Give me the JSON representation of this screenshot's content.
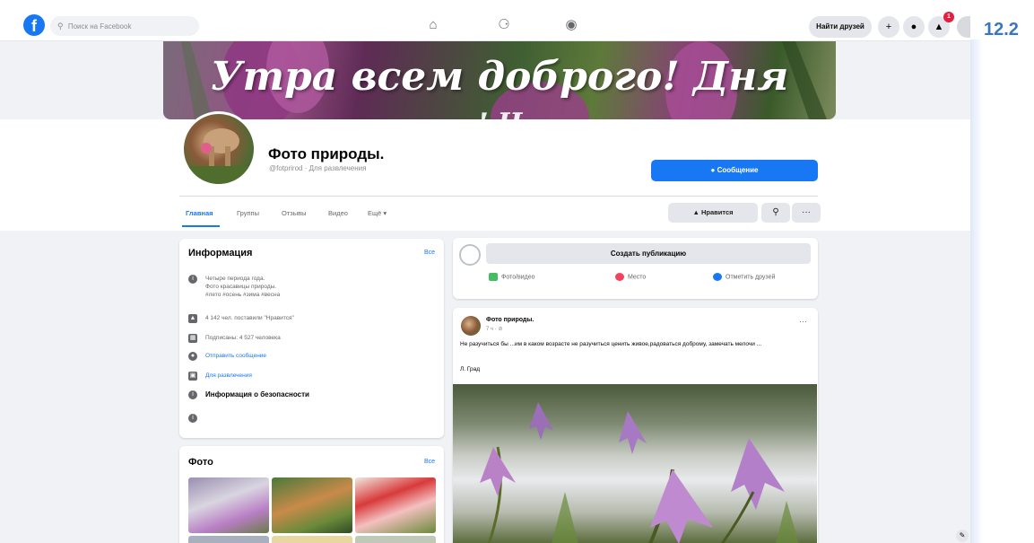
{
  "topbar": {
    "search_placeholder": "Поиск на Facebook",
    "find_friends": "Найти друзей",
    "notif_count": "1",
    "icons": [
      "facebook-logo",
      "search-icon",
      "home-icon",
      "friends-icon",
      "groups-icon",
      "plus-icon",
      "messenger-icon",
      "bell-icon"
    ]
  },
  "cover": {
    "line1": "Утра всем доброго! Дня",
    "line2": "! Ч"
  },
  "profile": {
    "name": "Фото природы.",
    "subtitle": "@fotprirod · Для развлечения",
    "message_button": "Сообщение"
  },
  "tabs": [
    "Главная",
    "Группы",
    "Отзывы",
    "Видео",
    "Ещё ▾"
  ],
  "actions": {
    "like": "Нравится"
  },
  "info": {
    "title": "Информация",
    "see_all": "Все",
    "description": [
      "Четыре периода года.",
      "Фото красавицы природы.",
      "#лето #осень #зима #весна"
    ],
    "likes": "4 142 чел. поставили \"Нравится\"",
    "followers": "Подписаны: 4 527 человека",
    "send_message": "Отправить сообщение",
    "category": "Для развлечения",
    "security": "Информация о безопасности"
  },
  "photos": {
    "title": "Фото",
    "see_all": "Все"
  },
  "composer": {
    "placeholder": "Создать публикацию",
    "photo_video": "Фото/видео",
    "place": "Место",
    "tag_friends": "Отметить друзей"
  },
  "post": {
    "author": "Фото природы.",
    "time": "7 ч · ⊘",
    "text": "Не разучиться бы ...им в каком возрасте не разучиться ценить живое,радоваться доброму, замечать мелочи ...",
    "signature": "Л. Град"
  },
  "chapter": "12.2",
  "colors": {
    "accent": "#1877f2",
    "background": "#f0f2f5",
    "chapter": "#3a75c4"
  }
}
